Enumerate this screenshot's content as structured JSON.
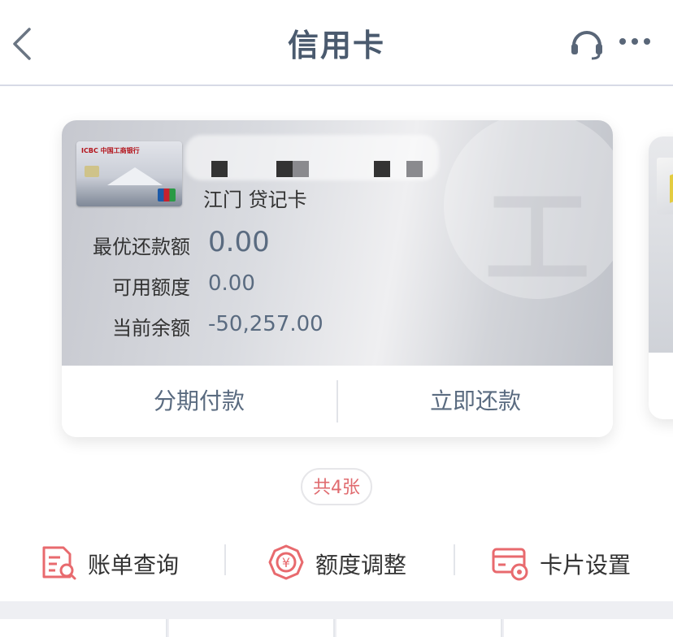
{
  "header": {
    "title": "信用卡"
  },
  "card": {
    "thumb_bank_name": "ICBC 中国工商银行",
    "type_label": "江门 贷记卡",
    "rows": [
      {
        "label": "最优还款额",
        "value": "0.00"
      },
      {
        "label": "可用额度",
        "value": "0.00"
      },
      {
        "label": "当前余额",
        "value": "-50,257.00"
      }
    ],
    "actions": {
      "installment": "分期付款",
      "repay_now": "立即还款"
    }
  },
  "card_count": "共4张",
  "functions": [
    {
      "label": "账单查询",
      "icon": "bill-query-icon"
    },
    {
      "label": "额度调整",
      "icon": "limit-adjust-icon"
    },
    {
      "label": "卡片设置",
      "icon": "card-settings-icon"
    }
  ],
  "colors": {
    "accent_red": "#e86a6e",
    "value_text": "#5a6b80",
    "title_text": "#4a5a6e"
  }
}
